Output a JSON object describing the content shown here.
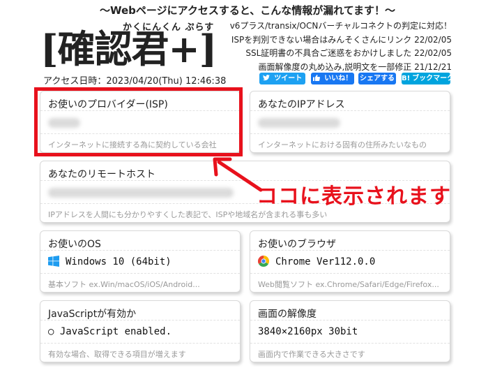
{
  "header": {
    "tagline": "〜Webページにアクセスすると、こんな情報が漏れてます！〜",
    "logo_text": "[確認君+]",
    "logo_ruby": "かくにんくん ぷらす",
    "access_time": "アクセス日時：2023/04/20(Thu) 12:46:38"
  },
  "news": [
    "v6プラス/transix/OCNバーチャルコネクトの判定に対応！",
    "ISPを判別できない場合はみんそくさんにリンク 22/02/05",
    "SSL証明書の不具合ご迷惑をおかけしました 22/02/05",
    "画面解像度の丸め込み,説明文を一部修正 21/12/21"
  ],
  "share_buttons": [
    {
      "label": "ツイート",
      "icon": "twitter-bird-icon",
      "color": "#1da1f2"
    },
    {
      "label": "いいね！",
      "icon": "facebook-like-icon",
      "color": "#1877f2"
    },
    {
      "label": "シェアする",
      "icon": "facebook-share-icon",
      "color": "#1877f2"
    },
    {
      "label": "ブックマーク",
      "icon": "hatena-bookmark-icon",
      "color": "#00a4de"
    }
  ],
  "cards": {
    "isp": {
      "title": "お使いのプロバイダー(ISP)",
      "value": "",
      "desc": "インターネットに接続する為に契約している会社"
    },
    "ip": {
      "title": "あなたのIPアドレス",
      "value": "",
      "desc": "インターネットにおける固有の住所みたいなもの"
    },
    "host": {
      "title": "あなたのリモートホスト",
      "value": "",
      "desc": "IPアドレスを人間にも分かりやすくした表記で、ISPや地域名が含まれる事も多い"
    },
    "os": {
      "title": "お使いのOS",
      "value": "Windows 10 (64bit)",
      "desc": "基本ソフト ex.Win/macOS/iOS/Android...",
      "icon": "windows-logo-icon"
    },
    "browser": {
      "title": "お使いのブラウザ",
      "value": "Chrome Ver112.0.0",
      "desc": "Web閲覧ソフト ex.Chrome/Safari/Edge/Firefox...",
      "icon": "chrome-logo-icon"
    },
    "js": {
      "title": "JavaScriptが有効か",
      "value": "○ JavaScript enabled.",
      "desc": "有効な場合、取得できる項目が増えます"
    },
    "resolution": {
      "title": "画面の解像度",
      "value": "3840×2160px 30bit",
      "desc": "画面内で作業できる大きさです"
    }
  },
  "annotation": {
    "text": "ココに表示されます",
    "color": "#e8111c"
  }
}
